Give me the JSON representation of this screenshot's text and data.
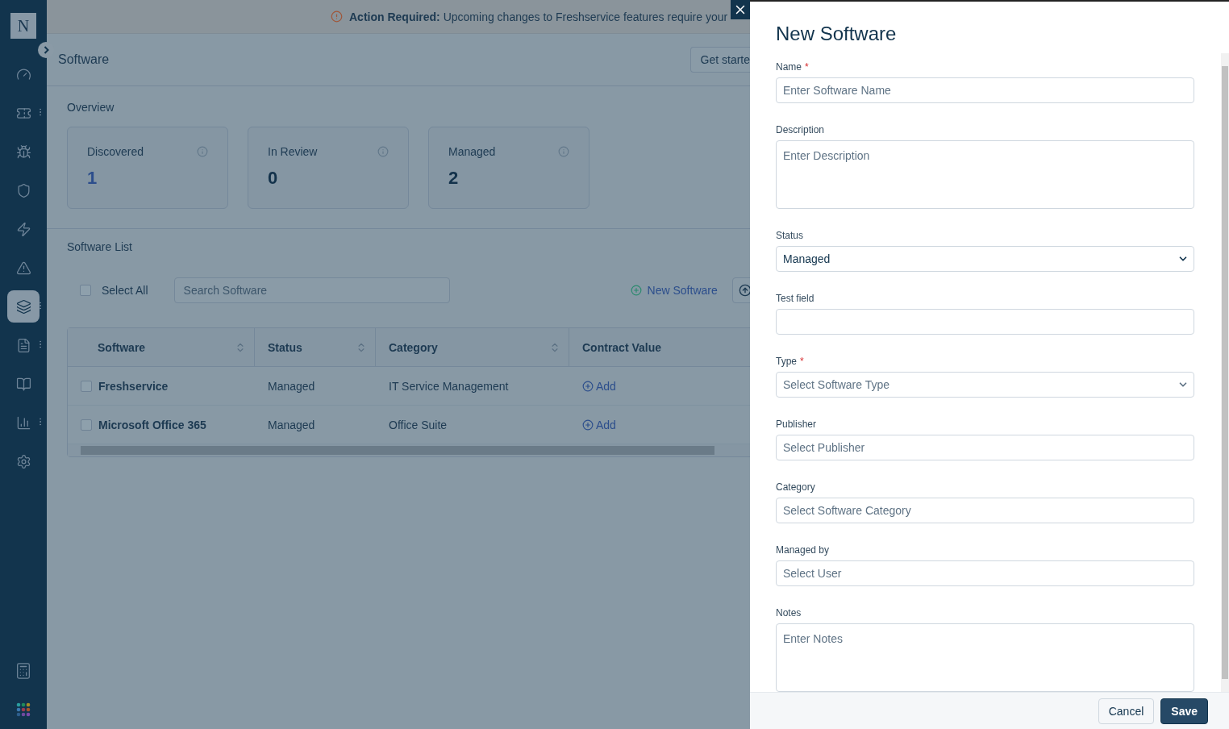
{
  "sidebar": {
    "logo": "N",
    "items": [
      {
        "selected": false,
        "menu": false
      },
      {
        "selected": false,
        "menu": true
      },
      {
        "selected": false,
        "menu": false
      },
      {
        "selected": false,
        "menu": false
      },
      {
        "selected": false,
        "menu": false
      },
      {
        "selected": false,
        "menu": false
      },
      {
        "selected": true,
        "menu": true
      },
      {
        "selected": false,
        "menu": true
      },
      {
        "selected": false,
        "menu": false
      },
      {
        "selected": false,
        "menu": true
      },
      {
        "selected": false,
        "menu": false
      }
    ]
  },
  "banner": {
    "label": "Action Required:",
    "text": "Upcoming changes to Freshservice features require your"
  },
  "header": {
    "title": "Software",
    "action": "Get starte"
  },
  "overview": {
    "title": "Overview",
    "cards": [
      {
        "label": "Discovered",
        "value": "1",
        "linked": true
      },
      {
        "label": "In Review",
        "value": "0",
        "linked": false
      },
      {
        "label": "Managed",
        "value": "2",
        "linked": false
      }
    ]
  },
  "software_list": {
    "title": "Software List",
    "select_all": {
      "label": "Select All",
      "checked": false
    },
    "search": {
      "placeholder": "Search Software"
    },
    "new_button": "New Software",
    "columns": [
      {
        "label": "Software",
        "sortable": true
      },
      {
        "label": "Status",
        "sortable": true
      },
      {
        "label": "Category",
        "sortable": true
      },
      {
        "label": "Contract Value",
        "sortable": false
      }
    ],
    "rows": [
      {
        "checked": false,
        "cells": [
          "Freshservice",
          "Managed",
          "IT Service Management",
          "Add"
        ]
      },
      {
        "checked": false,
        "cells": [
          "Microsoft Office 365",
          "Managed",
          "Office Suite",
          "Add"
        ]
      }
    ]
  },
  "drawer": {
    "title": "New Software",
    "fields": [
      {
        "label": "Name",
        "required_mark": "*",
        "kind": "text",
        "placeholder": "Enter Software Name"
      },
      {
        "label": "Description",
        "kind": "textarea",
        "placeholder": "Enter Description"
      },
      {
        "label": "Status",
        "kind": "select",
        "value": "Managed"
      },
      {
        "label": "Test field",
        "kind": "text"
      },
      {
        "label": "Type",
        "required_mark": "*",
        "kind": "select",
        "placeholder": "Select Software Type"
      },
      {
        "label": "Publisher",
        "kind": "text",
        "placeholder": "Select Publisher"
      },
      {
        "label": "Category",
        "kind": "text",
        "placeholder": "Select Software Category"
      },
      {
        "label": "Managed by",
        "kind": "text",
        "placeholder": "Select User"
      },
      {
        "label": "Notes",
        "kind": "textarea",
        "placeholder": "Enter Notes"
      }
    ],
    "buttons": [
      {
        "label": "Cancel",
        "kind": "secondary"
      },
      {
        "label": "Save",
        "kind": "primary"
      }
    ]
  }
}
